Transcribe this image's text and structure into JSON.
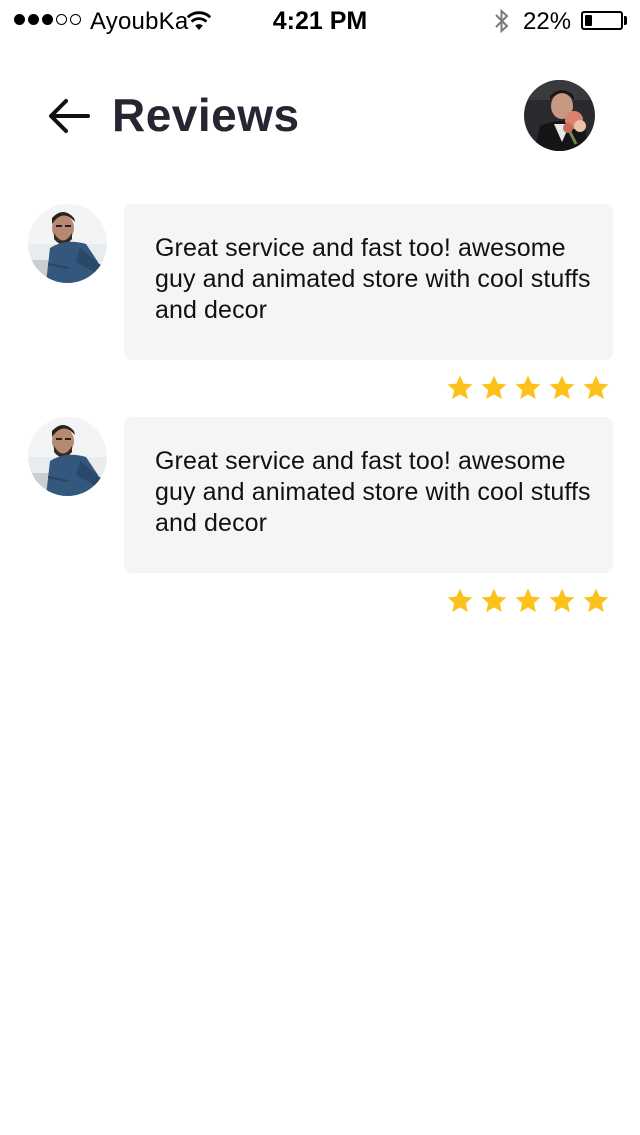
{
  "status_bar": {
    "carrier": "AyoubKa",
    "time": "4:21 PM",
    "battery_percent": "22%",
    "battery_level": 0.22,
    "signal_bars_filled": 3,
    "signal_bars_total": 5
  },
  "header": {
    "title": "Reviews",
    "back_icon": "arrow-left-icon",
    "profile_avatar": "user-avatar"
  },
  "reviews": [
    {
      "text": "Great service and fast too! awesome guy and animated store with cool stuffs and decor",
      "rating": 5,
      "max_rating": 5
    },
    {
      "text": "Great service and fast too! awesome guy and animated store with cool stuffs and decor",
      "rating": 5,
      "max_rating": 5
    }
  ],
  "colors": {
    "title": "#262632",
    "bubble_background": "#f5f5f5",
    "star": "#fcc21b"
  }
}
